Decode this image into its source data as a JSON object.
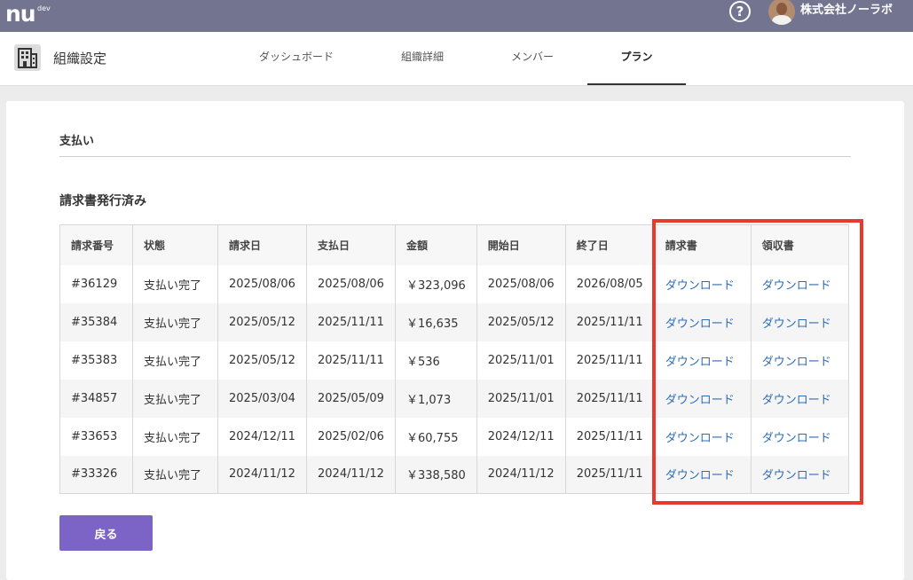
{
  "header": {
    "logo_main": "nu",
    "logo_sup": "dev",
    "help_symbol": "?",
    "company_name": "株式会社ノーラボ"
  },
  "subheader": {
    "org_title": "組織設定",
    "tabs": [
      {
        "label": "ダッシュボード",
        "active": false
      },
      {
        "label": "組織詳細",
        "active": false
      },
      {
        "label": "メンバー",
        "active": false
      },
      {
        "label": "プラン",
        "active": true
      }
    ]
  },
  "main": {
    "section_title": "支払い",
    "subsection_title": "請求書発行済み",
    "table": {
      "columns": [
        "請求番号",
        "状態",
        "請求日",
        "支払日",
        "金額",
        "開始日",
        "終了日",
        "請求書",
        "領収書"
      ],
      "rows": [
        [
          "#36129",
          "支払い完了",
          "2025/08/06",
          "2025/08/06",
          "￥323,096",
          "2025/08/06",
          "2026/08/05",
          "ダウンロード",
          "ダウンロード"
        ],
        [
          "#35384",
          "支払い完了",
          "2025/05/12",
          "2025/11/11",
          "￥16,635",
          "2025/05/12",
          "2025/11/11",
          "ダウンロード",
          "ダウンロード"
        ],
        [
          "#35383",
          "支払い完了",
          "2025/05/12",
          "2025/11/11",
          "￥536",
          "2025/11/01",
          "2025/11/11",
          "ダウンロード",
          "ダウンロード"
        ],
        [
          "#34857",
          "支払い完了",
          "2025/03/04",
          "2025/05/09",
          "￥1,073",
          "2025/11/01",
          "2025/11/11",
          "ダウンロード",
          "ダウンロード"
        ],
        [
          "#33653",
          "支払い完了",
          "2024/12/11",
          "2025/02/06",
          "￥60,755",
          "2024/12/11",
          "2025/11/11",
          "ダウンロード",
          "ダウンロード"
        ],
        [
          "#33326",
          "支払い完了",
          "2024/11/12",
          "2024/11/12",
          "￥338,580",
          "2024/11/12",
          "2025/11/11",
          "ダウンロード",
          "ダウンロード"
        ]
      ]
    },
    "back_button": "戻る"
  },
  "icons": {
    "help": "help-icon",
    "avatar": "avatar",
    "org": "building-icon"
  },
  "colors": {
    "topbar": "#737590",
    "link": "#2f6db5",
    "highlight": "#e8392f",
    "button": "#7c63c6"
  }
}
